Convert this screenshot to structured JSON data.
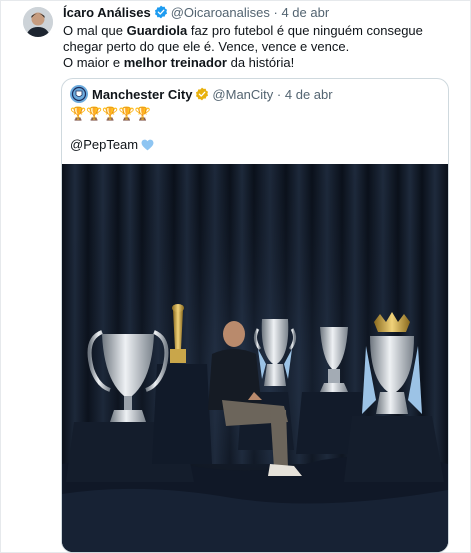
{
  "tweet": {
    "author_name": "Ícaro Análises",
    "handle": "@Oicaroanalises",
    "separator": "·",
    "date": "4 de abr",
    "text_line1_a": "O mal que ",
    "text_line1_bold": "Guardiola",
    "text_line1_b": " faz pro futebol é que ninguém consegue chegar perto do que ele é. Vence, vence e vence.",
    "text_line2_a": "O maior e ",
    "text_line2_bold": "melhor treinador",
    "text_line2_b": " da história!"
  },
  "quoted": {
    "author_name": "Manchester City",
    "handle": "@ManCity",
    "separator": "·",
    "date": "4 de abr",
    "trophies_text": "🏆🏆🏆🏆🏆",
    "mention": "@PepTeam"
  },
  "colors": {
    "verified_badge": "#f4b400",
    "quote_border": "#cfd9de",
    "heart": "#8ec5f2",
    "photo_background": "#0d131e"
  },
  "icons": {
    "verified": "verified-badge-icon",
    "heart": "light-blue-heart-icon",
    "trophy": "trophy-icon"
  }
}
